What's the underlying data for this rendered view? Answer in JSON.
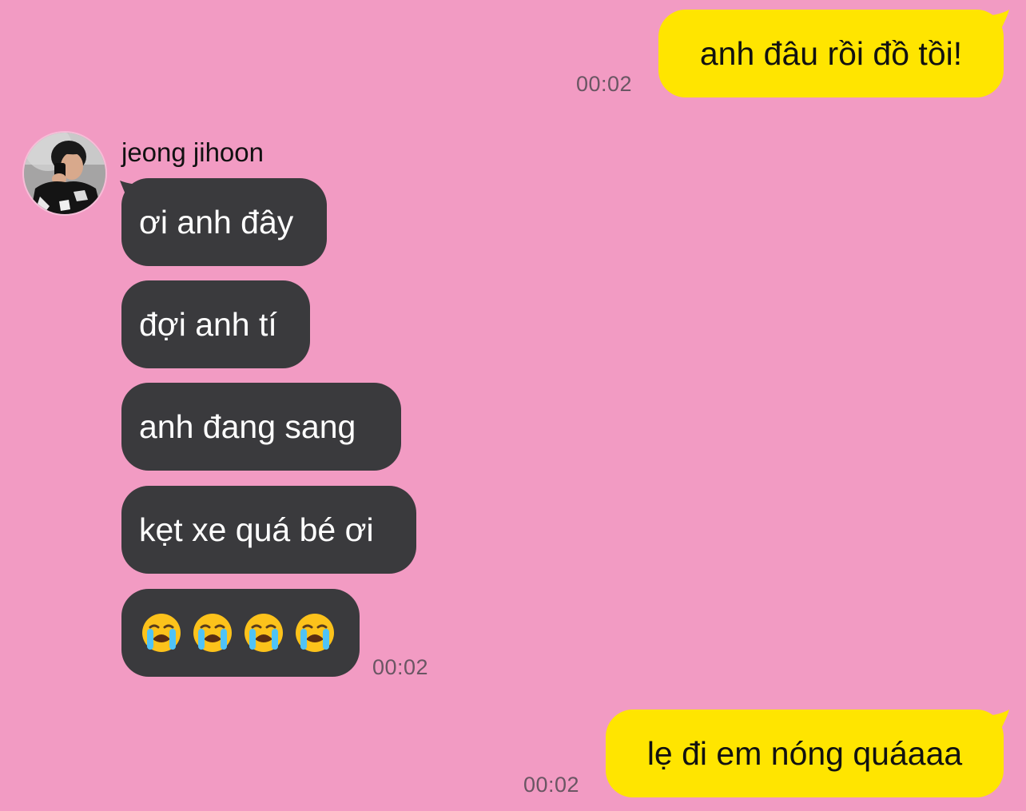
{
  "messages": {
    "m1": {
      "text": "anh đâu rồi đồ tồi!",
      "time": "00:02"
    },
    "sender_name": "jeong jihoon",
    "m2": {
      "text": "ơi anh đây"
    },
    "m3": {
      "text": "đợi anh tí"
    },
    "m4": {
      "text": "anh đang sang"
    },
    "m5": {
      "text": "kẹt xe quá bé ơi"
    },
    "m6": {
      "emoji": [
        "loudly-crying-face",
        "loudly-crying-face",
        "loudly-crying-face",
        "loudly-crying-face"
      ],
      "time": "00:02"
    },
    "m7": {
      "text": "lẹ đi em nóng quáaaa",
      "time": "00:02"
    }
  },
  "colors": {
    "background": "#f29bc3",
    "outgoing_bubble": "#ffe500",
    "incoming_bubble": "#3a3a3d",
    "timestamp": "#6a5663"
  }
}
